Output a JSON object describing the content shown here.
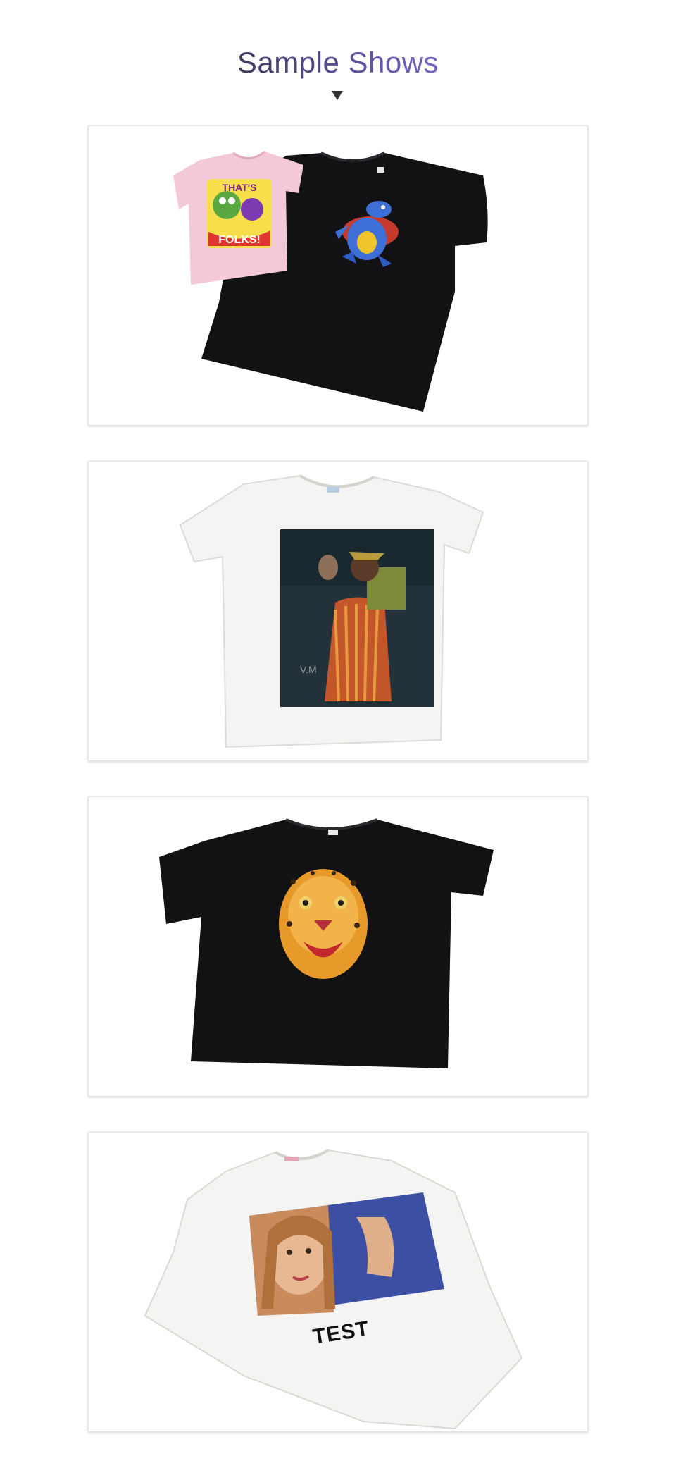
{
  "header": {
    "title": "Sample Shows",
    "caret_icon": "caret-down-icon"
  },
  "samples": [
    {
      "id": "pink-and-black-kids-shirts",
      "print_text": "THAT'S FOLKS!"
    },
    {
      "id": "white-shirt-portrait-print",
      "print_text": "V.M"
    },
    {
      "id": "black-shirt-leopard-print",
      "print_text": ""
    },
    {
      "id": "white-shirt-photo-print",
      "print_text": "TEST"
    }
  ],
  "colors": {
    "title_start": "#3d3b5c",
    "title_end": "#7466c4",
    "card_border": "#e2e2e2",
    "pink_shirt": "#f3c8d8",
    "black_shirt": "#121214",
    "white_shirt": "#f4f4f2"
  }
}
